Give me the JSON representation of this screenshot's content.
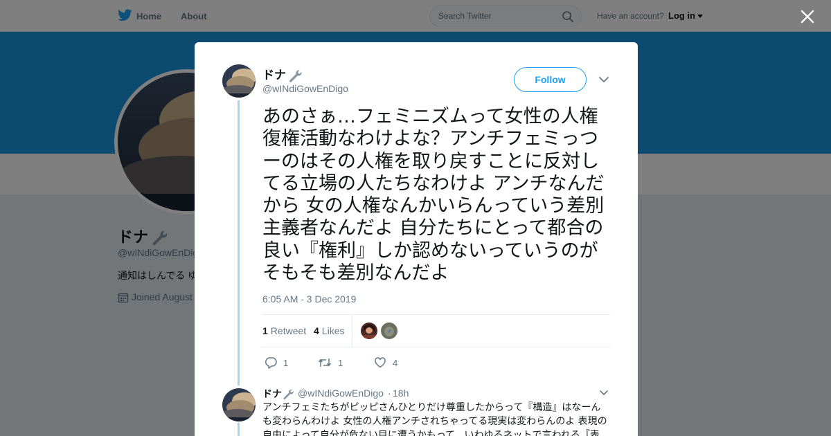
{
  "topbar": {
    "home_label": "Home",
    "about_label": "About",
    "search_placeholder": "Search Twitter",
    "account_prompt": "Have an account?",
    "login_label": "Log in"
  },
  "profile": {
    "name": "ドナ",
    "handle": "@wINdiGowEnDigo",
    "bio": "通知はしんでる ゆ",
    "joined": "Joined August"
  },
  "tweet": {
    "author_name": "ドナ",
    "author_handle": "@wINdiGowEnDigo",
    "follow_label": "Follow",
    "text": "あのさぁ…フェミニズムって女性の人権復権活動なわけよな？アンチフェミっつーのはその人権を取り戻すことに反対してる立場の人たちなわけよ アンチなんだから 女の人権なんかいらんっていう差別主義者なんだよ 自分たちにとって都合の良い『権利』しか認めないっていうのがそもそも差別なんだよ",
    "timestamp": "6:05 AM - 3 Dec 2019",
    "retweet_count": "1",
    "retweet_label": "Retweet",
    "like_count": "4",
    "like_label": "Likes",
    "reply_action_count": "1",
    "retweet_action_count": "1",
    "like_action_count": "4"
  },
  "reply": {
    "author_name": "ドナ",
    "author_handle": "@wINdiGowEnDigo",
    "separator": "·",
    "time": "18h",
    "text": "アンチフェミたちがピッピさんひとりだけ尊重したからって『構造』はなーんも変わらんわけよ 女性の人権アンチされちゃってる現実は変わらんのよ 表現の自由によって自分が危ない目に遭うかもって、いわゆるネットで言われる『表"
  },
  "colors": {
    "brand": "#1da1f2",
    "banner": "#1b95e0",
    "thread_line": "#a6d4f2"
  },
  "icons": [
    "twitter-bird-icon",
    "search-icon",
    "close-icon",
    "wrench-icon",
    "chevron-down-icon",
    "reply-icon",
    "retweet-icon",
    "heart-icon",
    "calendar-icon"
  ]
}
